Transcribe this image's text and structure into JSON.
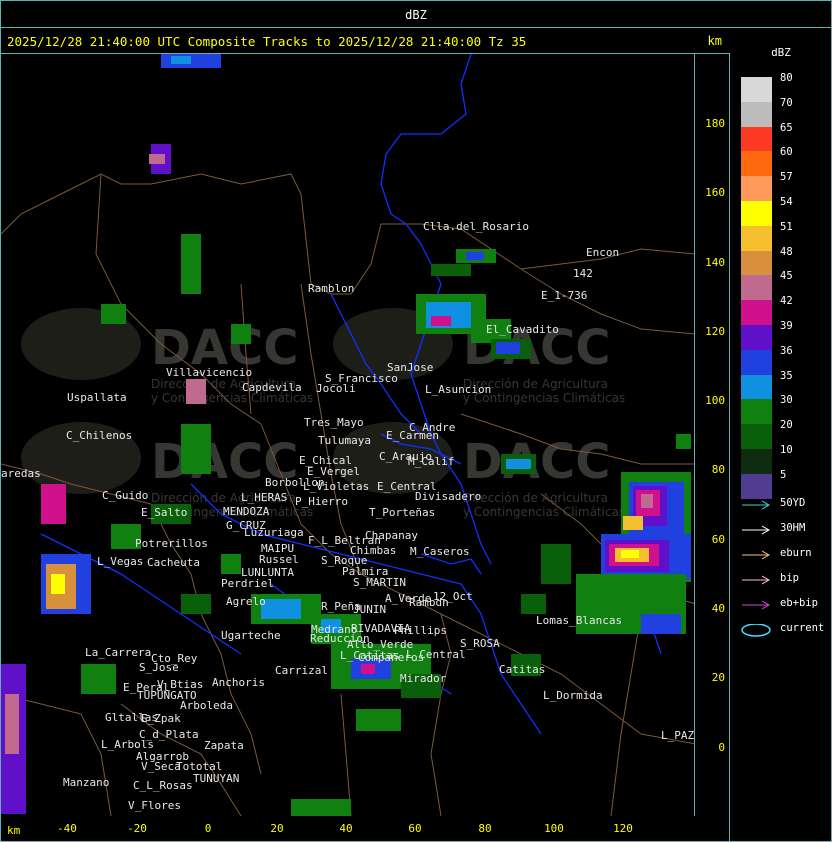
{
  "window": {
    "title": "dBZ"
  },
  "header": {
    "title": "2025/12/28 21:40:00 UTC Composite Tracks to 2025/12/28 21:40:00 Tz 35",
    "km": "km"
  },
  "axes": {
    "y_ticks": [
      "180",
      "160",
      "140",
      "120",
      "100",
      "80",
      "60",
      "40",
      "20",
      "0"
    ],
    "x_ticks": [
      "-40",
      "-20",
      "0",
      "20",
      "40",
      "60",
      "80",
      "100",
      "120"
    ],
    "x_unit": "km"
  },
  "legend": {
    "title": "dBZ",
    "scale": [
      {
        "label": "80",
        "color": "#d8d8d8"
      },
      {
        "label": "70",
        "color": "#bcbcbc"
      },
      {
        "label": "65",
        "color": "#ff3a24"
      },
      {
        "label": "60",
        "color": "#ff6a10"
      },
      {
        "label": "57",
        "color": "#ff9a5a"
      },
      {
        "label": "54",
        "color": "#ffff00"
      },
      {
        "label": "51",
        "color": "#f4c030"
      },
      {
        "label": "48",
        "color": "#d8903c"
      },
      {
        "label": "45",
        "color": "#c06a90"
      },
      {
        "label": "42",
        "color": "#d0108c"
      },
      {
        "label": "39",
        "color": "#6010c8"
      },
      {
        "label": "36",
        "color": "#2040e0"
      },
      {
        "label": "35",
        "color": "#1090e0"
      },
      {
        "label": "30",
        "color": "#108010"
      },
      {
        "label": "20",
        "color": "#0a600a"
      },
      {
        "label": "10",
        "color": "#102c10"
      },
      {
        "label": "5",
        "color": "#503c90"
      }
    ],
    "tracks": [
      {
        "label": "50YD",
        "color": "#40d0d0"
      },
      {
        "label": "30HM",
        "color": "#ffffff"
      },
      {
        "label": "eburn",
        "color": "#f0c080"
      },
      {
        "label": "bip",
        "color": "#ffc0d0"
      },
      {
        "label": "eb+bip",
        "color": "#e040e0"
      },
      {
        "label": "current",
        "color": "#40e0ff"
      }
    ]
  },
  "watermark": {
    "brand": "DACC",
    "line1": "Dirección de Agricultura",
    "line2": "y Contingencias Climáticas"
  },
  "places": [
    "Clla.del_Rosario",
    "Encon",
    "Ramblon",
    "E_1-736",
    "142",
    "El_Cavadito",
    "Villavicencio",
    "Capdevila",
    "S_Francisco",
    "SanJose",
    "L_Asuncion",
    "Uspallata",
    "Tres_Mayo",
    "Jocoli",
    "Tulumaya",
    "E_Carmen",
    "C_Andre",
    "C_Chilenos",
    "E_Chical",
    "C_Araujo",
    "M_Calif",
    "E_Vergel",
    "Borbollon",
    "L_Violetas",
    "E_Central",
    "Divisadero",
    "C_Guido",
    "L_HERAS",
    "P_Hierro",
    "E_Salto",
    "MENDOZA",
    "T_Porteñas",
    "G_CRUZ",
    "Luzuriaga",
    "Chapanay",
    "F_L_Beltran",
    "Chimbas",
    "M_Caseros",
    "Potrerillos",
    "MAIPU",
    "Russel",
    "L_Vegas",
    "Cacheuta",
    "LUNLUNTA",
    "Palmira",
    "S_Roque",
    "S_MARTIN",
    "Perdriel",
    "Agrelo",
    "R_Peña",
    "JUNIN",
    "A_Verde",
    "Rambdn",
    "Ugarteche",
    "Medrano",
    "RIVADAVIA",
    "Phillips",
    "12_Oct",
    "Lomas_Blancas",
    "Reduccion",
    "Alto_Verde",
    "S_ROSA",
    "La_Carrera",
    "Cto_Rey",
    "S_Jose",
    "Carrizal",
    "L_Catitas",
    "Compañeros",
    "L_Central",
    "Catitas",
    "V_Btias",
    "Anchoris",
    "E_Peral",
    "TUPUNGATO",
    "Mirador",
    "L_Dormida",
    "Arboleda",
    "Gltallas",
    "E_Zpak",
    "C_d_Plata",
    "L_Arbols",
    "Zapata",
    "Algarrob",
    "V_Seca",
    "Tototal",
    "TUNUYAN",
    "Manzano",
    "C_L_Rosas",
    "V_Flores",
    "L_PAZ",
    "aredas"
  ]
}
